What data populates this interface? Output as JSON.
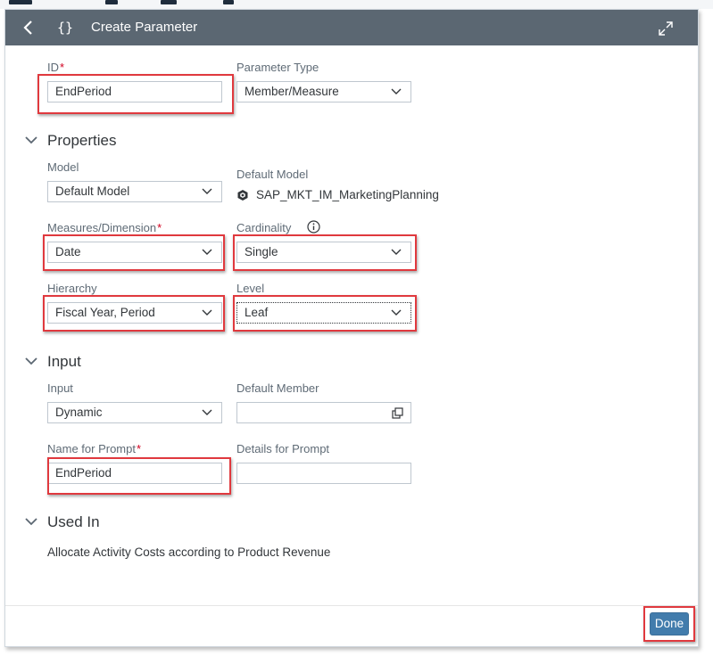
{
  "dialog": {
    "title": "Create Parameter",
    "header_icon": "{}",
    "done_label": "Done"
  },
  "fields": {
    "id": {
      "label": "ID",
      "required": "*",
      "value": "EndPeriod"
    },
    "parameter_type": {
      "label": "Parameter Type",
      "value": "Member/Measure"
    }
  },
  "properties": {
    "title": "Properties",
    "model": {
      "label": "Model",
      "value": "Default Model"
    },
    "default_model": {
      "label": "Default Model",
      "value": "SAP_MKT_IM_MarketingPlanning"
    },
    "measures_dimension": {
      "label": "Measures/Dimension",
      "required": "*",
      "value": "Date"
    },
    "cardinality": {
      "label": "Cardinality",
      "value": "Single"
    },
    "hierarchy": {
      "label": "Hierarchy",
      "value": "Fiscal Year, Period"
    },
    "level": {
      "label": "Level",
      "value": "Leaf"
    }
  },
  "input_section": {
    "title": "Input",
    "input": {
      "label": "Input",
      "value": "Dynamic"
    },
    "default_member": {
      "label": "Default Member",
      "value": ""
    },
    "name_for_prompt": {
      "label": "Name for Prompt",
      "required": "*",
      "value": "EndPeriod"
    },
    "details_for_prompt": {
      "label": "Details for Prompt",
      "value": ""
    }
  },
  "used_in": {
    "title": "Used In",
    "text": "Allocate Activity Costs according to Product Revenue"
  },
  "icons": {
    "back": "chevron-left-icon",
    "expand": "expand-icon",
    "info": "info-icon",
    "model": "model-cube-icon",
    "lookup": "value-help-icon",
    "dropdown": "chevron-down-icon"
  },
  "colors": {
    "header_bg": "#5b6772",
    "highlight": "#e0393e",
    "primary_button": "#427cac",
    "required": "#d1001f"
  }
}
